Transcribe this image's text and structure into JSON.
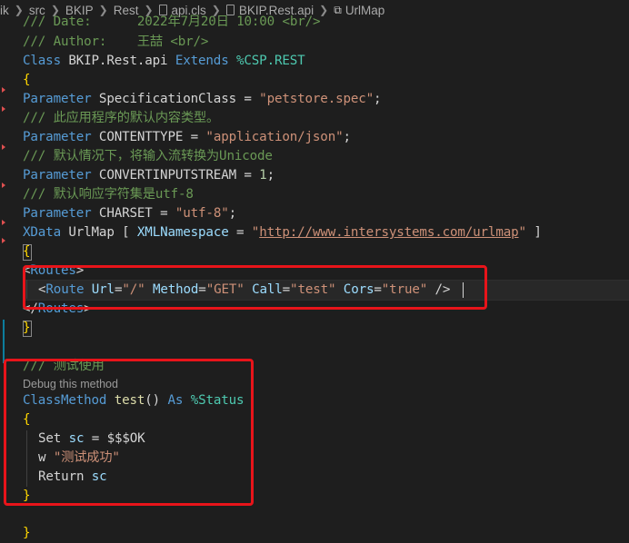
{
  "breadcrumb": {
    "items": [
      "ik",
      "src",
      "BKIP",
      "Rest",
      "api.cls",
      "BKIP.Rest.api",
      "UrlMap"
    ],
    "icons": [
      "file-icon",
      "class-icon"
    ]
  },
  "code": {
    "line_date": {
      "comment": "/// Date:      2022年7月20日 10:00 <br/>"
    },
    "line_author": {
      "comment": "/// Author:    王喆 <br/>"
    },
    "line_class": {
      "kw1": "Class",
      "name": " BKIP.Rest.api ",
      "kw2": "Extends",
      "sp": " ",
      "super": "%CSP.REST"
    },
    "line_open": {
      "brace": "{"
    },
    "line_spec": {
      "kw": "Parameter",
      "name": " SpecificationClass ",
      "eq": "= ",
      "value": "\"petstore.spec\"",
      "end": ";"
    },
    "line_c1": {
      "comment": "/// 此应用程序的默认内容类型。"
    },
    "line_ct": {
      "kw": "Parameter",
      "name": " CONTENTTYPE ",
      "eq": "= ",
      "value": "\"application/json\"",
      "end": ";"
    },
    "line_c2": {
      "comment": "/// 默认情况下，将输入流转换为Unicode"
    },
    "line_conv": {
      "kw": "Parameter",
      "name": " CONVERTINPUTSTREAM ",
      "eq": "= ",
      "value": "1",
      "end": ";"
    },
    "line_c3": {
      "comment": "/// 默认响应字符集是utf-8"
    },
    "line_cs": {
      "kw": "Parameter",
      "name": " CHARSET ",
      "eq": "= ",
      "value": "\"utf-8\"",
      "end": ";"
    },
    "line_xdata": {
      "kw": "XData",
      "name": " UrlMap ",
      "lb": "[ ",
      "attr": "XMLNamespace",
      "eq": " = ",
      "q1": "\"",
      "url": "http://www.intersystems.com/urlmap",
      "q2": "\"",
      "rb": " ]"
    },
    "line_xopen": {
      "brace": "{"
    },
    "line_routes_open": {
      "lt": "<",
      "tag": "Routes",
      "gt": ">"
    },
    "line_route": {
      "lt": "<",
      "tag": "Route",
      "a1": " Url",
      "e1": "=",
      "v1": "\"/\"",
      "a2": " Method",
      "e2": "=",
      "v2": "\"GET\"",
      "a3": " Call",
      "e3": "=",
      "v3": "\"test\"",
      "a4": " Cors",
      "e4": "=",
      "v4": "\"true\"",
      "end": " />"
    },
    "line_routes_close": {
      "lt": "</",
      "tag": "Routes",
      "gt": ">"
    },
    "line_xclose": {
      "brace": "}"
    },
    "line_c4": {
      "comment": "/// 测试使用"
    },
    "codelens": "Debug this method",
    "line_method": {
      "kw": "ClassMethod",
      "name": " test",
      "paren": "()",
      "sp": " ",
      "as": "As",
      "sp2": " ",
      "ret": "%Status"
    },
    "line_mopen": {
      "brace": "{"
    },
    "line_set": {
      "kw": "Set",
      "var": " sc",
      "eq": " = ",
      "val": "$$$OK"
    },
    "line_w": {
      "kw": "w",
      "sp": " ",
      "str": "\"测试成功\""
    },
    "line_ret": {
      "kw": "Return",
      "var": " sc"
    },
    "line_mclose": {
      "brace": "}"
    },
    "line_close": {
      "brace": "}"
    }
  },
  "colors": {
    "background": "#1e1e1e",
    "highlight_box": "#e8141a",
    "comment": "#6a9955",
    "keyword": "#569cd6",
    "string": "#ce9178"
  }
}
